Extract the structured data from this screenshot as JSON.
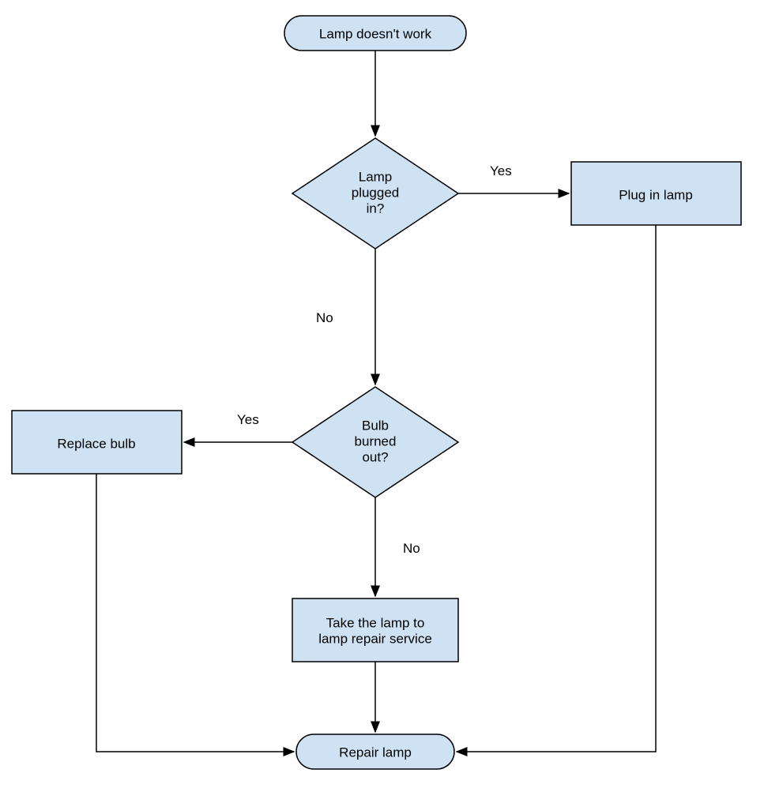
{
  "nodes": {
    "start": {
      "label": "Lamp doesn't work"
    },
    "plugged": {
      "line1": "Lamp",
      "line2": "plugged",
      "line3": "in?"
    },
    "plugin": {
      "label": "Plug in lamp"
    },
    "burned": {
      "line1": "Bulb",
      "line2": "burned",
      "line3": "out?"
    },
    "replace": {
      "label": "Replace bulb"
    },
    "repair_service": {
      "line1": "Take the lamp to",
      "line2": "lamp repair service"
    },
    "end": {
      "label": "Repair lamp"
    }
  },
  "edges": {
    "plugged_yes": "Yes",
    "plugged_no": "No",
    "burned_yes": "Yes",
    "burned_no": "No"
  },
  "colors": {
    "fill": "#cfe2f3",
    "stroke": "#000000"
  }
}
